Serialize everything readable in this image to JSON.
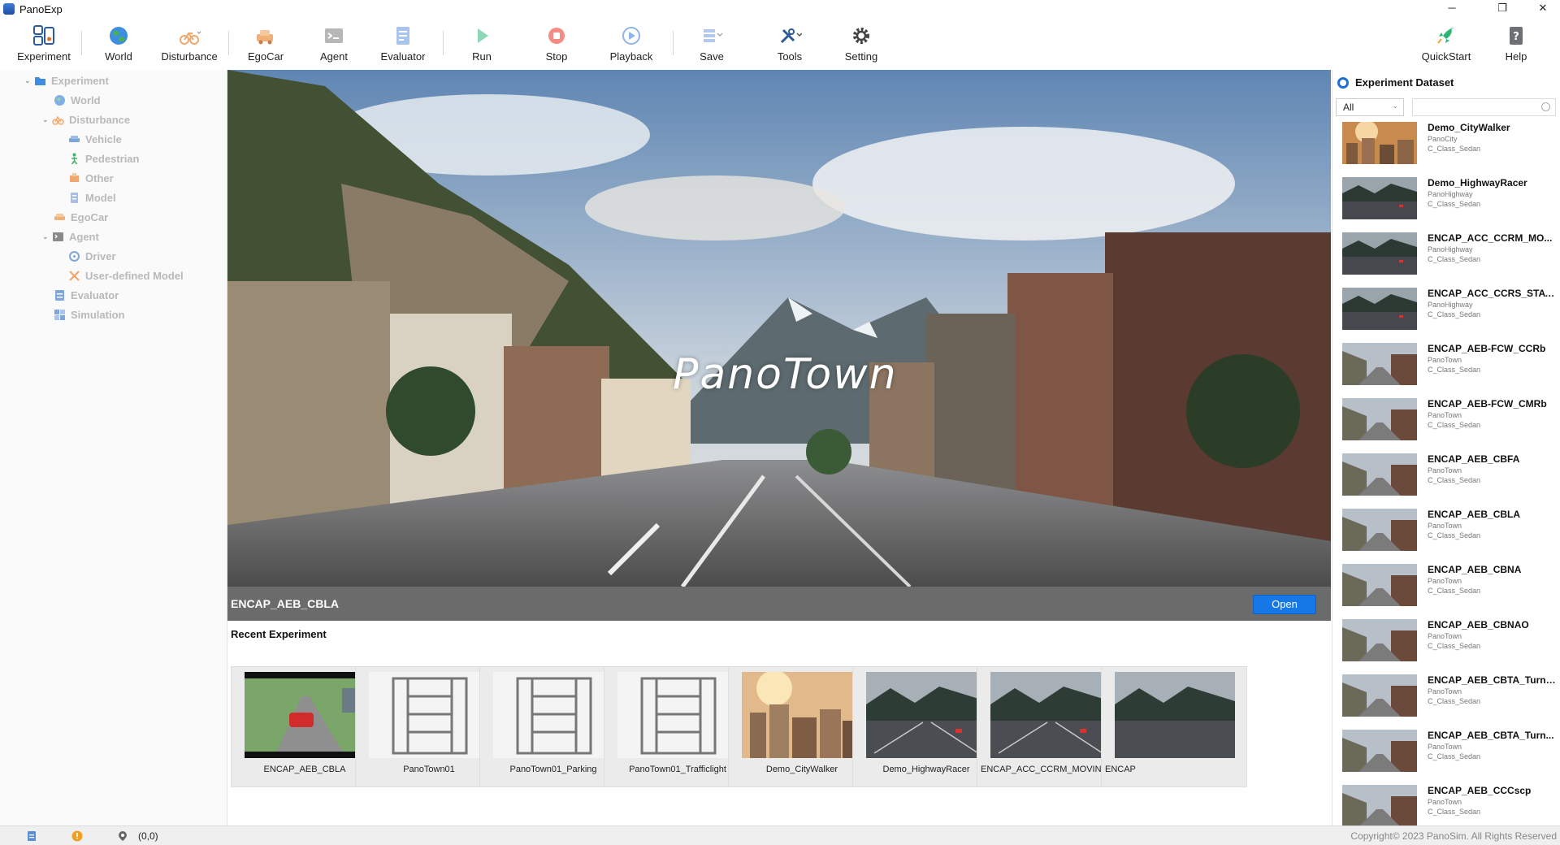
{
  "app": {
    "title": "PanoExp"
  },
  "window": {
    "minimize": "─",
    "restore": "❐",
    "close": "✕"
  },
  "toolbar": {
    "experiment": "Experiment",
    "world": "World",
    "disturbance": "Disturbance",
    "egocar": "EgoCar",
    "agent": "Agent",
    "evaluator": "Evaluator",
    "run": "Run",
    "stop": "Stop",
    "playback": "Playback",
    "save": "Save",
    "tools": "Tools",
    "setting": "Setting",
    "quickstart": "QuickStart",
    "help": "Help"
  },
  "tree": {
    "experiment": "Experiment",
    "world": "World",
    "disturbance": "Disturbance",
    "vehicle": "Vehicle",
    "pedestrian": "Pedestrian",
    "other": "Other",
    "model": "Model",
    "egocar": "EgoCar",
    "agent": "Agent",
    "driver": "Driver",
    "user_defined_model": "User-defined Model",
    "evaluator": "Evaluator",
    "simulation": "Simulation"
  },
  "hero": {
    "title": "PanoTown",
    "experiment_name": "ENCAP_AEB_CBLA",
    "open_label": "Open"
  },
  "recent": {
    "title": "Recent Experiment",
    "items": [
      {
        "name": "ENCAP_AEB_CBLA",
        "thumb": "photo-car"
      },
      {
        "name": "PanoTown01",
        "thumb": "map-icon"
      },
      {
        "name": "PanoTown01_Parking",
        "thumb": "map-icon"
      },
      {
        "name": "PanoTown01_Trafficlight",
        "thumb": "map-icon"
      },
      {
        "name": "Demo_CityWalker",
        "thumb": "photo-city"
      },
      {
        "name": "Demo_HighwayRacer",
        "thumb": "photo-highway"
      },
      {
        "name": "ENCAP_ACC_CCRM_MOVING_TAR...",
        "thumb": "photo-highway"
      },
      {
        "name": "ENCAP",
        "thumb": "photo-highway"
      }
    ]
  },
  "dataset": {
    "title": "Experiment Dataset",
    "filter": "All",
    "search_placeholder": "",
    "items": [
      {
        "name": "Demo_CityWalker",
        "map": "PanoCity",
        "car": "C_Class_Sedan",
        "thumb": "city"
      },
      {
        "name": "Demo_HighwayRacer",
        "map": "PanoHighway",
        "car": "C_Class_Sedan",
        "thumb": "highway"
      },
      {
        "name": "ENCAP_ACC_CCRM_MO...",
        "map": "PanoHighway",
        "car": "C_Class_Sedan",
        "thumb": "highway"
      },
      {
        "name": "ENCAP_ACC_CCRS_STATI...",
        "map": "PanoHighway",
        "car": "C_Class_Sedan",
        "thumb": "highway"
      },
      {
        "name": "ENCAP_AEB-FCW_CCRb",
        "map": "PanoTown",
        "car": "C_Class_Sedan",
        "thumb": "town"
      },
      {
        "name": "ENCAP_AEB-FCW_CMRb",
        "map": "PanoTown",
        "car": "C_Class_Sedan",
        "thumb": "town"
      },
      {
        "name": "ENCAP_AEB_CBFA",
        "map": "PanoTown",
        "car": "C_Class_Sedan",
        "thumb": "town"
      },
      {
        "name": "ENCAP_AEB_CBLA",
        "map": "PanoTown",
        "car": "C_Class_Sedan",
        "thumb": "town"
      },
      {
        "name": "ENCAP_AEB_CBNA",
        "map": "PanoTown",
        "car": "C_Class_Sedan",
        "thumb": "town"
      },
      {
        "name": "ENCAP_AEB_CBNAO",
        "map": "PanoTown",
        "car": "C_Class_Sedan",
        "thumb": "town"
      },
      {
        "name": "ENCAP_AEB_CBTA_TurnL...",
        "map": "PanoTown",
        "car": "C_Class_Sedan",
        "thumb": "town"
      },
      {
        "name": "ENCAP_AEB_CBTA_Turn...",
        "map": "PanoTown",
        "car": "C_Class_Sedan",
        "thumb": "town"
      },
      {
        "name": "ENCAP_AEB_CCCscp",
        "map": "PanoTown",
        "car": "C_Class_Sedan",
        "thumb": "town"
      }
    ]
  },
  "status": {
    "coords": "(0,0)",
    "copyright": "Copyright© 2023 PanoSim. All Rights Reserved"
  },
  "colors": {
    "accent": "#1677e6",
    "hero_bar": "#6b6b6b",
    "tree_text": "#b9b9b9"
  }
}
